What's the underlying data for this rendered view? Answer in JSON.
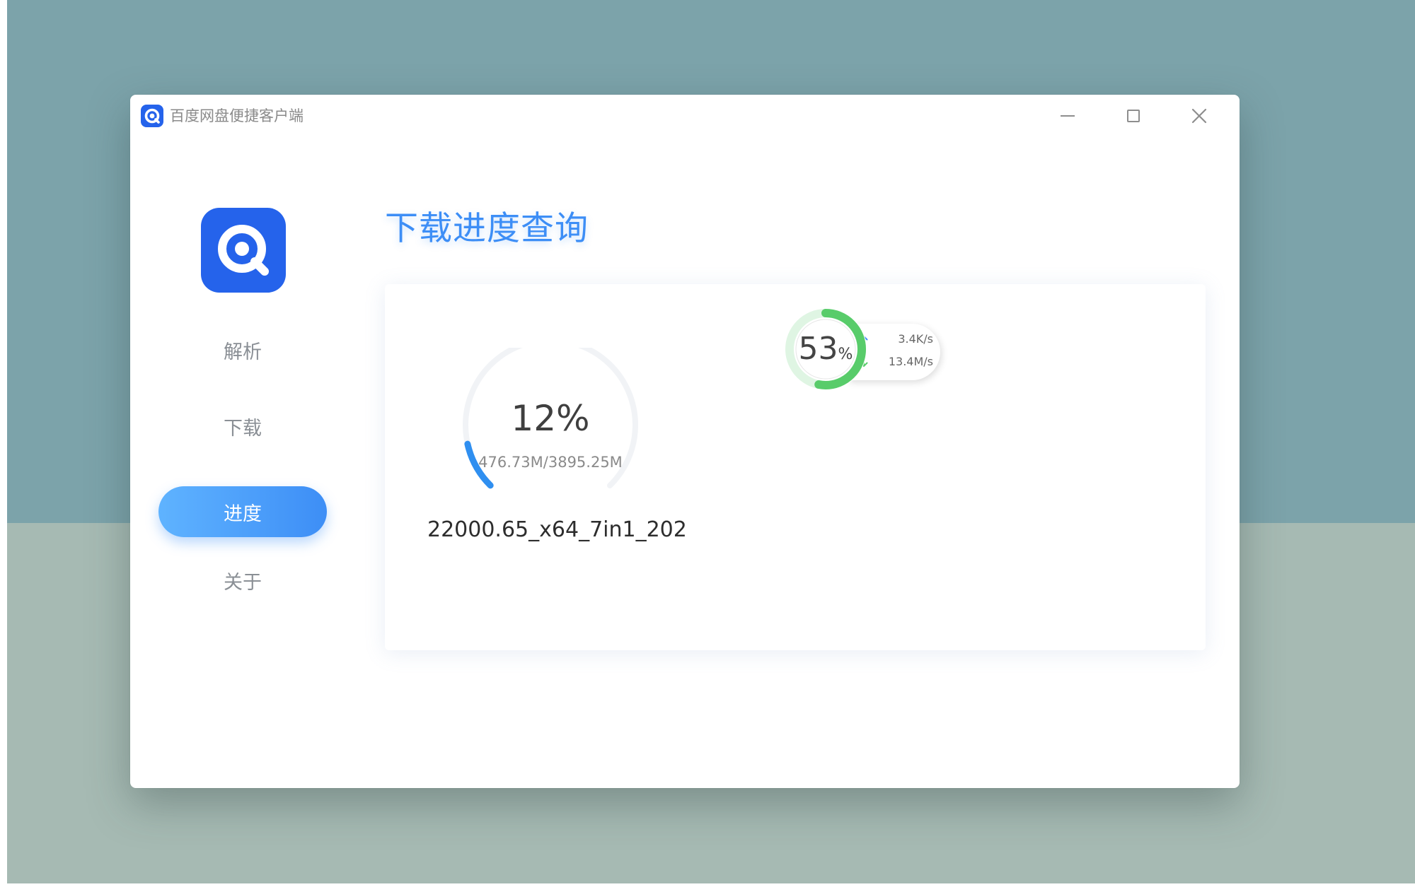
{
  "window": {
    "title": "百度网盘便捷客户端",
    "controls": {
      "minimize_icon": "minimize-icon",
      "maximize_icon": "maximize-icon",
      "close_icon": "close-icon"
    }
  },
  "sidebar": {
    "logo_icon": "baidu-netdisk-logo-icon",
    "items": [
      {
        "label": "解析",
        "active": false
      },
      {
        "label": "下载",
        "active": false
      },
      {
        "label": "进度",
        "active": true
      },
      {
        "label": "关于",
        "active": false
      }
    ]
  },
  "main": {
    "title": "下载进度查询",
    "download": {
      "progress": 0.12,
      "percent_label": "12%",
      "size_label": "476.73M/3895.25M",
      "file_name": "22000.65_x64_7in1_202"
    },
    "speed_widget": {
      "progress": 0.53,
      "percent_value": "53",
      "percent_unit": "%",
      "upload_speed": "3.4K/s",
      "download_speed": "13.4M/s"
    }
  },
  "colors": {
    "accent": "#3d8ef6",
    "progress_arc": "#2f8ff0",
    "speed_ring": "#58cc6a",
    "background_top": "#7ca3aa",
    "background_bottom": "#a6bab3"
  }
}
